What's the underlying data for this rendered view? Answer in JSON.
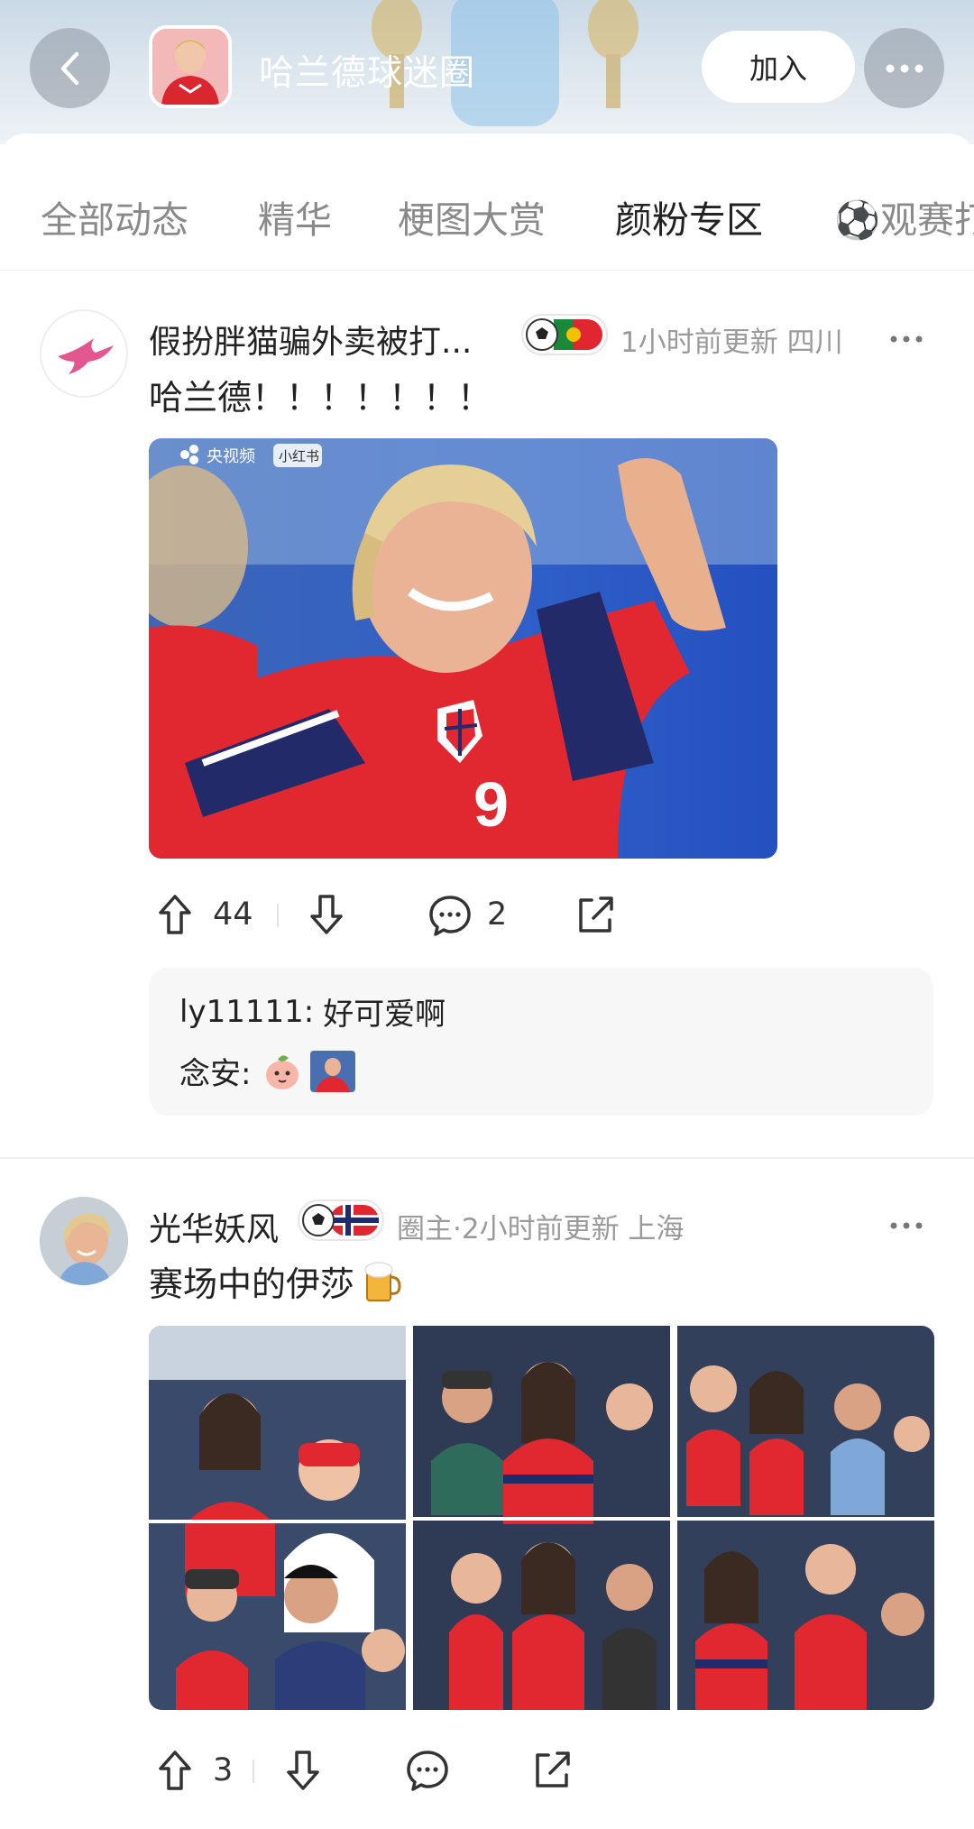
{
  "header": {
    "circle_name": "哈兰德球迷圈",
    "join_label": "加入",
    "back_icon": "back-chevron-icon",
    "more_icon": "more-dots-icon"
  },
  "tabs": [
    {
      "label": "全部动态",
      "active": false
    },
    {
      "label": "精华",
      "active": false
    },
    {
      "label": "梗图大赏",
      "active": false
    },
    {
      "label": "颜粉专区",
      "active": true
    },
    {
      "label": "⚽观赛打",
      "active": false
    }
  ],
  "post1": {
    "author": "假扮胖猫骗外卖被打...",
    "badge": "football-portugal-flag-badge",
    "meta": "1小时前更新 四川",
    "text": "哈兰德！！！！！！！",
    "image_watermark": "央视频",
    "image_watermark_tag": "小红书",
    "upvotes": "44",
    "comments": "2",
    "comment_preview": [
      {
        "user": "ly11111:",
        "text": "好可爱啊"
      },
      {
        "user": "念安:",
        "text": ""
      }
    ]
  },
  "post2": {
    "author": "光华妖风",
    "badge": "football-norway-flag-badge",
    "meta": "圈主·2小时前更新 上海",
    "text": "赛场中的伊莎",
    "text_emoji": "🍺",
    "upvotes": "3"
  },
  "colors": {
    "accent": "#222222",
    "muted": "#9a9a9a",
    "norway_red": "#e0262f",
    "norway_blue": "#1f2b6b"
  }
}
